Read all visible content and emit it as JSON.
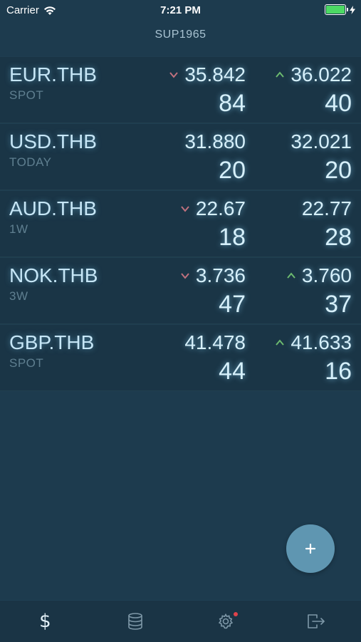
{
  "status_bar": {
    "carrier": "Carrier",
    "time": "7:21 PM"
  },
  "header": {
    "title": "SUP1965"
  },
  "colors": {
    "background": "#1d3b4e",
    "row_background": "#1a3546",
    "arrow_down": "#c0717e",
    "arrow_up": "#6cba6f",
    "fab": "#5f96b1",
    "notification_dot": "#e0434b"
  },
  "rates": [
    {
      "pair": "EUR.THB",
      "tenor": "SPOT",
      "bid": {
        "big": "35.842",
        "pips": "84",
        "arrow": "down"
      },
      "ask": {
        "big": "36.022",
        "pips": "40",
        "arrow": "up"
      }
    },
    {
      "pair": "USD.THB",
      "tenor": "TODAY",
      "bid": {
        "big": "31.880",
        "pips": "20",
        "arrow": "none"
      },
      "ask": {
        "big": "32.021",
        "pips": "20",
        "arrow": "none"
      }
    },
    {
      "pair": "AUD.THB",
      "tenor": "1W",
      "bid": {
        "big": "22.67",
        "pips": "18",
        "arrow": "down"
      },
      "ask": {
        "big": "22.77",
        "pips": "28",
        "arrow": "none"
      }
    },
    {
      "pair": "NOK.THB",
      "tenor": "3W",
      "bid": {
        "big": "3.736",
        "pips": "47",
        "arrow": "down"
      },
      "ask": {
        "big": "3.760",
        "pips": "37",
        "arrow": "up"
      }
    },
    {
      "pair": "GBP.THB",
      "tenor": "SPOT",
      "bid": {
        "big": "41.478",
        "pips": "44",
        "arrow": "none"
      },
      "ask": {
        "big": "41.633",
        "pips": "16",
        "arrow": "up"
      }
    }
  ],
  "tab_bar": {
    "tabs": [
      {
        "icon": "dollar-icon",
        "glyph": "$",
        "active": true
      },
      {
        "icon": "database-icon",
        "active": false
      },
      {
        "icon": "gear-icon",
        "active": false,
        "notification": true
      },
      {
        "icon": "logout-icon",
        "active": false
      }
    ]
  }
}
